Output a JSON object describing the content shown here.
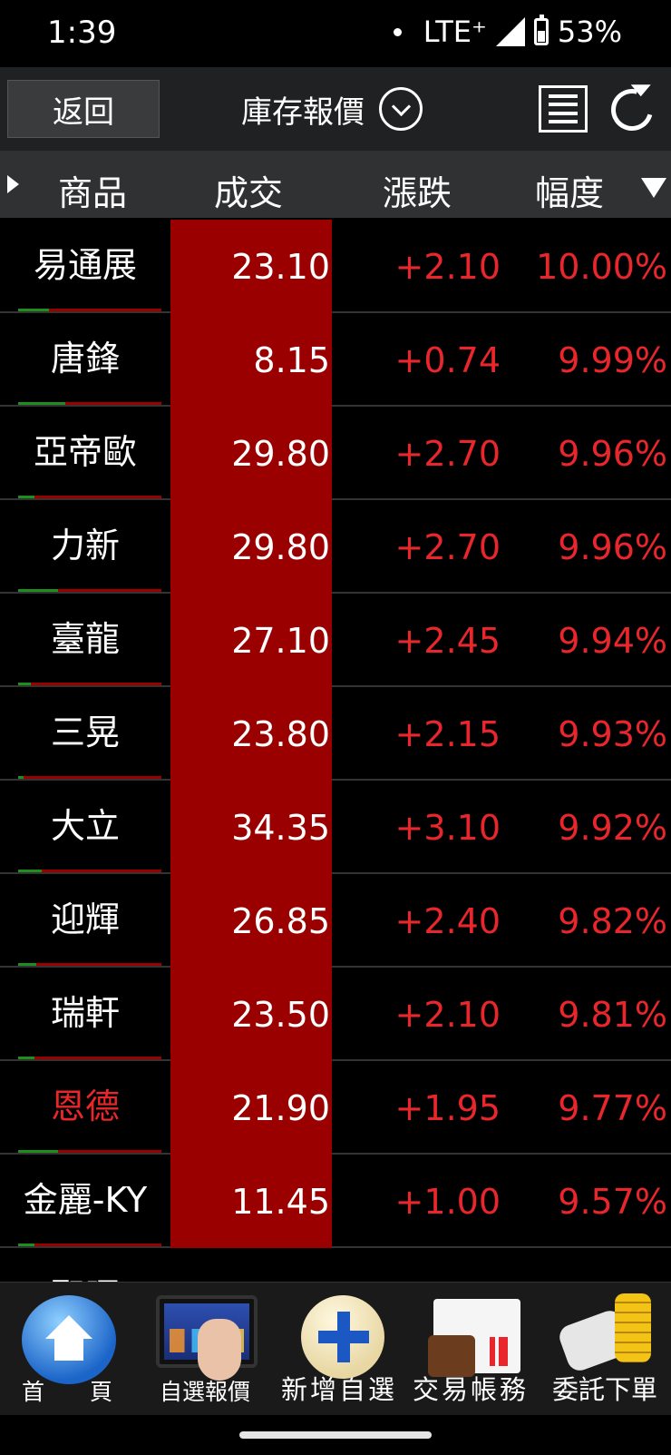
{
  "status_bar": {
    "time": "1:39",
    "network": "LTE⁺",
    "battery": "53%"
  },
  "header": {
    "back_label": "返回",
    "title": "庫存報價"
  },
  "columns": {
    "name": "商品",
    "price": "成交",
    "change": "漲跌",
    "percent": "幅度"
  },
  "rows": [
    {
      "name": "易通展",
      "price": "23.10",
      "change": "+2.10",
      "percent": "10.00%"
    },
    {
      "name": "唐鋒",
      "price": "8.15",
      "change": "+0.74",
      "percent": "9.99%"
    },
    {
      "name": "亞帝歐",
      "price": "29.80",
      "change": "+2.70",
      "percent": "9.96%"
    },
    {
      "name": "力新",
      "price": "29.80",
      "change": "+2.70",
      "percent": "9.96%"
    },
    {
      "name": "臺龍",
      "price": "27.10",
      "change": "+2.45",
      "percent": "9.94%"
    },
    {
      "name": "三晃",
      "price": "23.80",
      "change": "+2.15",
      "percent": "9.93%"
    },
    {
      "name": "大立",
      "price": "34.35",
      "change": "+3.10",
      "percent": "9.92%"
    },
    {
      "name": "迎輝",
      "price": "26.85",
      "change": "+2.40",
      "percent": "9.82%"
    },
    {
      "name": "瑞軒",
      "price": "23.50",
      "change": "+2.10",
      "percent": "9.81%"
    },
    {
      "name": "恩德",
      "price": "21.90",
      "change": "+1.95",
      "percent": "9.77%"
    },
    {
      "name": "金麗-KY",
      "price": "11.45",
      "change": "+1.00",
      "percent": "9.57%"
    },
    {
      "name": "聖暉",
      "price": "",
      "change": "",
      "percent": ""
    }
  ],
  "bottom_nav": [
    {
      "label": "首　　頁",
      "icon": "home-icon"
    },
    {
      "label": "自選報價",
      "icon": "tablet-chart-icon"
    },
    {
      "label": "新增自選",
      "icon": "plus-icon"
    },
    {
      "label": "交易帳務",
      "icon": "wallet-icon"
    },
    {
      "label": "委託下單",
      "icon": "coins-icon"
    }
  ],
  "colors": {
    "up": "#e8262b",
    "price_bg": "#9a0000",
    "header_bg": "#303133",
    "nav_bg": "#202122"
  }
}
